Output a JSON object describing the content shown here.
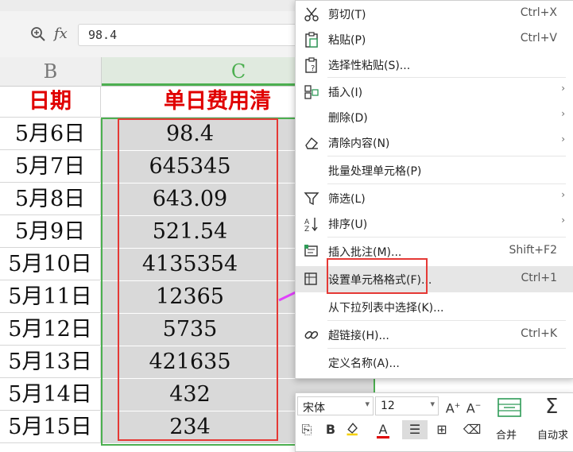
{
  "formula_bar": {
    "fx": "fx",
    "value": "98.4",
    "zoom_icon": "zoom-search-icon"
  },
  "columns": {
    "b": "B",
    "c": "C"
  },
  "sheet": {
    "header_date": "日期",
    "header_expense": "单日费用清",
    "rows": [
      {
        "date": "5月6日",
        "value": "98.4"
      },
      {
        "date": "5月7日",
        "value": "645345"
      },
      {
        "date": "5月8日",
        "value": "643.09"
      },
      {
        "date": "5月9日",
        "value": "521.54"
      },
      {
        "date": "5月10日",
        "value": "4135354"
      },
      {
        "date": "5月11日",
        "value": "12365"
      },
      {
        "date": "5月12日",
        "value": "5735"
      },
      {
        "date": "5月13日",
        "value": "421635"
      },
      {
        "date": "5月14日",
        "value": "432"
      },
      {
        "date": "5月15日",
        "value": "234"
      }
    ]
  },
  "context_menu": {
    "items": [
      {
        "label": "剪切(T)",
        "shortcut": "Ctrl+X",
        "icon": "scissors-icon",
        "submenu": false
      },
      {
        "label": "粘贴(P)",
        "shortcut": "Ctrl+V",
        "icon": "paste-icon",
        "submenu": false
      },
      {
        "label": "选择性粘贴(S)...",
        "shortcut": "",
        "icon": "paste-special-icon",
        "submenu": false
      },
      {
        "label": "插入(I)",
        "shortcut": "",
        "icon": "insert-icon",
        "submenu": true
      },
      {
        "label": "删除(D)",
        "shortcut": "",
        "icon": "",
        "submenu": true
      },
      {
        "label": "清除内容(N)",
        "shortcut": "",
        "icon": "eraser-icon",
        "submenu": true
      },
      {
        "label": "批量处理单元格(P)",
        "shortcut": "",
        "icon": "",
        "submenu": false
      },
      {
        "label": "筛选(L)",
        "shortcut": "",
        "icon": "filter-icon",
        "submenu": true
      },
      {
        "label": "排序(U)",
        "shortcut": "",
        "icon": "sort-icon",
        "submenu": true
      },
      {
        "label": "插入批注(M)...",
        "shortcut": "Shift+F2",
        "icon": "comment-icon",
        "submenu": false
      },
      {
        "label": "设置单元格格式(F)...",
        "shortcut": "Ctrl+1",
        "icon": "format-cells-icon",
        "submenu": false
      },
      {
        "label": "从下拉列表中选择(K)...",
        "shortcut": "",
        "icon": "",
        "submenu": false
      },
      {
        "label": "超链接(H)...",
        "shortcut": "Ctrl+K",
        "icon": "link-icon",
        "submenu": false
      },
      {
        "label": "定义名称(A)...",
        "shortcut": "",
        "icon": "",
        "submenu": false
      }
    ]
  },
  "mini_toolbar": {
    "font": "宋体",
    "size": "12",
    "bold": "B",
    "font_color_letter": "A",
    "merge_label": "合并",
    "autosum_label": "自动求"
  },
  "colors": {
    "accent_green": "#4caf50",
    "highlight_red": "#e53935",
    "header_red": "#e00000",
    "arrow_magenta": "#e040fb"
  }
}
